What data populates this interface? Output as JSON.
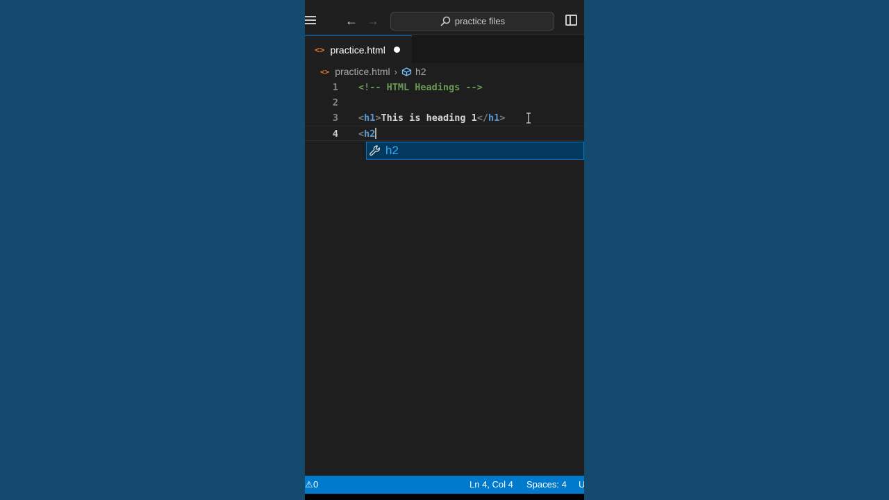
{
  "titlebar": {
    "search_text": "practice files"
  },
  "tab": {
    "label": "practice.html",
    "dirty": true
  },
  "breadcrumb": {
    "file": "practice.html",
    "symbol": "h2"
  },
  "editor": {
    "lines": [
      {
        "number": "1",
        "text": "<!-- HTML Headings -->"
      },
      {
        "number": "2",
        "text": ""
      },
      {
        "number": "3",
        "text": "<h1>This is heading 1</h1>"
      },
      {
        "number": "4",
        "text": "<h2"
      }
    ],
    "current_line": 4
  },
  "suggestion": {
    "label": "h2",
    "icon": "wrench-icon"
  },
  "statusbar": {
    "problems": "0",
    "position": "Ln 4, Col 4",
    "indentation": "Spaces: 4",
    "encoding_partial": "U"
  },
  "colors": {
    "background": "#144a6e",
    "editor_bg": "#1e1e1e",
    "statusbar_bg": "#007acc",
    "comment": "#6a9955",
    "tag": "#569cd6",
    "suggestion_text": "#2aaaff"
  }
}
